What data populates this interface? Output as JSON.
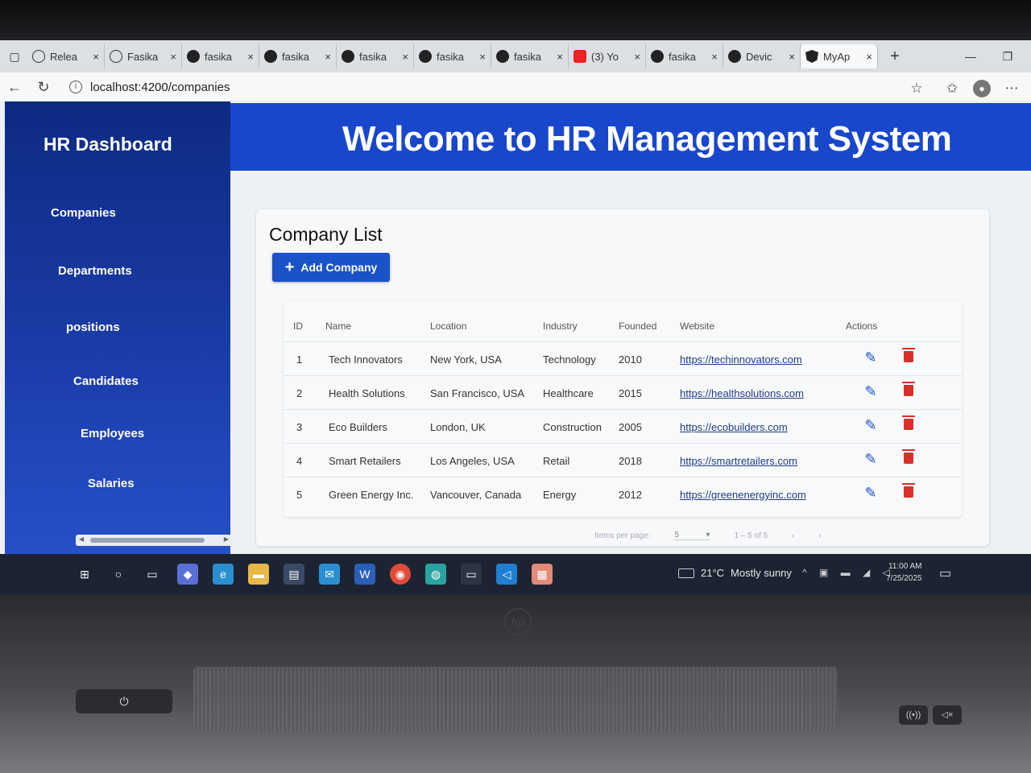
{
  "browser": {
    "tabs": [
      {
        "label": "Relea",
        "icon": "globe-icon"
      },
      {
        "label": "Fasika",
        "icon": "globe-icon"
      },
      {
        "label": "fasika",
        "icon": "github-icon"
      },
      {
        "label": "fasika",
        "icon": "github-icon"
      },
      {
        "label": "fasika",
        "icon": "github-icon"
      },
      {
        "label": "fasika",
        "icon": "github-icon"
      },
      {
        "label": "fasika",
        "icon": "github-icon"
      },
      {
        "label": "(3) Yo",
        "icon": "youtube-icon"
      },
      {
        "label": "fasika",
        "icon": "github-icon"
      },
      {
        "label": "Devic",
        "icon": "github-icon"
      },
      {
        "label": "MyAp",
        "icon": "angular-icon"
      }
    ],
    "close_glyph": "×",
    "new_tab_glyph": "+",
    "url": "localhost:4200/companies"
  },
  "sidebar": {
    "title": "HR Dashboard",
    "items": [
      "Companies",
      "Departments",
      "positions",
      "Candidates",
      "Employees",
      "Salaries"
    ]
  },
  "header": {
    "title": "Welcome to HR Management System"
  },
  "company_list": {
    "title": "Company List",
    "add_button_label": "Add Company",
    "columns": [
      "ID",
      "Name",
      "Location",
      "Industry",
      "Founded",
      "Website",
      "Actions"
    ],
    "rows": [
      {
        "id": "1",
        "name": "Tech Innovators",
        "location": "New York, USA",
        "industry": "Technology",
        "founded": "2010",
        "website": "https://techinnovators.com"
      },
      {
        "id": "2",
        "name": "Health Solutions",
        "location": "San Francisco, USA",
        "industry": "Healthcare",
        "founded": "2015",
        "website": "https://healthsolutions.com"
      },
      {
        "id": "3",
        "name": "Eco Builders",
        "location": "London, UK",
        "industry": "Construction",
        "founded": "2005",
        "website": "https://ecobuilders.com"
      },
      {
        "id": "4",
        "name": "Smart Retailers",
        "location": "Los Angeles, USA",
        "industry": "Retail",
        "founded": "2018",
        "website": "https://smartretailers.com"
      },
      {
        "id": "5",
        "name": "Green Energy Inc.",
        "location": "Vancouver, Canada",
        "industry": "Energy",
        "founded": "2012",
        "website": "https://greenenergyinc.com"
      }
    ],
    "paginator": {
      "items_per_page_label": "Items per page:",
      "page_size": "5",
      "range_label": "1 – 5 of 5"
    }
  },
  "taskbar": {
    "weather_temp": "21°C",
    "weather_text": "Mostly sunny",
    "time": "11:00 AM",
    "date": "7/25/2025"
  },
  "colors": {
    "sidebar": "#0d2a83",
    "banner": "#1947cc",
    "primary_button": "#1a52c8",
    "edit_icon": "#1a4fc4",
    "delete_icon": "#d9302b"
  }
}
